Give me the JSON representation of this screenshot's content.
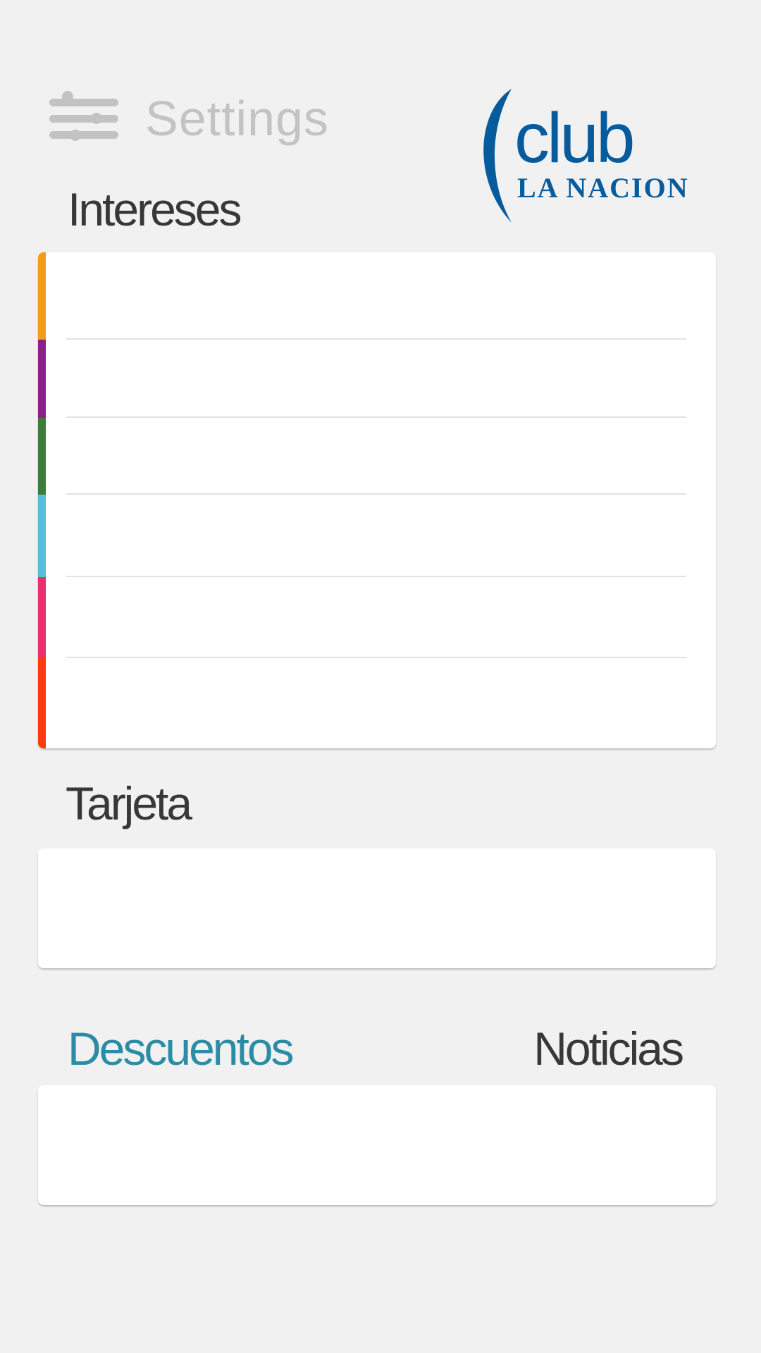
{
  "header": {
    "settings_label": "Settings",
    "settings_icon": "sliders-icon"
  },
  "logo": {
    "club_text": "club",
    "brand_text": "LA NACION",
    "color": "#065b9c"
  },
  "sections": {
    "intereses_title": "Intereses",
    "tarjeta_title": "Tarjeta"
  },
  "interests": {
    "colors": [
      "#f39c1b",
      "#8e2085",
      "#3f7b3b",
      "#55c1d6",
      "#e6306f",
      "#ff3a0f"
    ]
  },
  "tabs": {
    "descuentos": "Descuentos",
    "noticias": "Noticias",
    "active_color": "#2b8ca6"
  }
}
